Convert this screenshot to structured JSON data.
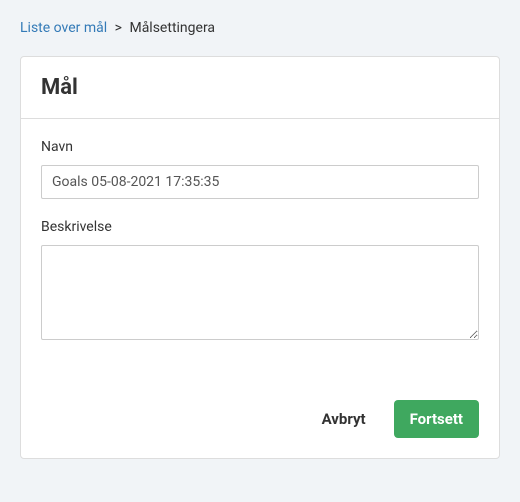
{
  "breadcrumb": {
    "link_label": "Liste over mål",
    "separator": ">",
    "current": "Målsettingera"
  },
  "card": {
    "title": "Mål",
    "name_label": "Navn",
    "name_value": "Goals 05-08-2021 17:35:35",
    "description_label": "Beskrivelse",
    "description_value": ""
  },
  "actions": {
    "cancel": "Avbryt",
    "continue": "Fortsett"
  }
}
